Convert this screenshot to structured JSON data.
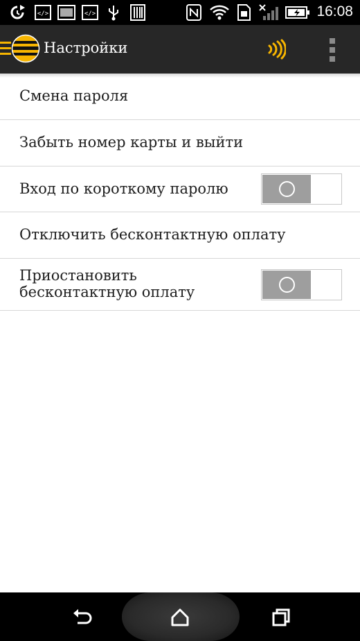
{
  "status_bar": {
    "time": "16:08",
    "icons": [
      "sync-icon",
      "dev-code-icon",
      "image-icon",
      "dev-code-icon",
      "usb-icon",
      "barcode-icon",
      "nfc-n-icon",
      "wifi-icon",
      "sim-icon",
      "signal-icon",
      "battery-charging-icon"
    ]
  },
  "app_bar": {
    "title": "Настройки",
    "nav_icon": "drawer-menu-icon",
    "logo": "beeline-logo",
    "action_icon": "contactless-icon",
    "overflow_icon": "overflow-menu-icon"
  },
  "settings": {
    "items": [
      {
        "label": "Смена пароля"
      },
      {
        "label": "Забыть номер карты и выйти"
      },
      {
        "label": "Вход по короткому паролю",
        "toggle": "off"
      },
      {
        "label": "Отключить бесконтактную оплату"
      },
      {
        "label_line1": "Приостановить",
        "label_line2": "бесконтактную оплату",
        "toggle": "off"
      }
    ]
  },
  "nav_bar": {
    "buttons": [
      "back-icon",
      "home-icon",
      "recents-icon"
    ]
  },
  "colors": {
    "accent": "#f7b500",
    "app_bar": "#272727",
    "toggle_off": "#9e9e9e"
  }
}
